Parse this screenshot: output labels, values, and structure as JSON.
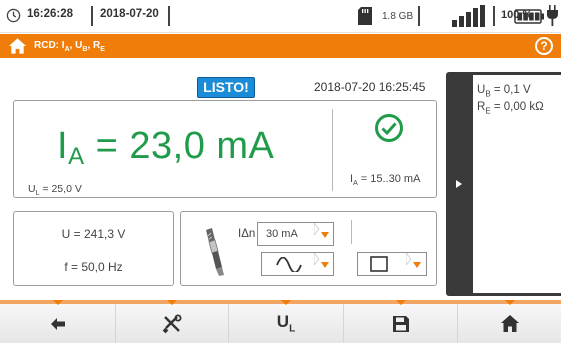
{
  "status_bar": {
    "time": "16:26:28",
    "date": "2018-07-20",
    "storage": "1.8 GB",
    "battery": "100 %",
    "icons": [
      "clock-icon",
      "sd-card-icon",
      "signal-bars-icon",
      "battery-icon",
      "plug-icon"
    ]
  },
  "header": {
    "title": "RCD: I",
    "title_sub_a": "A",
    "title_sep1": ", U",
    "title_sub_b": "B",
    "title_sep2": ", R",
    "title_sub_e": "E",
    "help": "?",
    "icons": [
      "home-icon",
      "help-icon"
    ]
  },
  "measurement": {
    "status": "LISTO!",
    "timestamp": "2018-07-20 16:25:45",
    "main_symbol": "I",
    "main_sub": "A",
    "main_value": " = 23,0 mA",
    "ul_symbol": "U",
    "ul_sub": "L",
    "ul_value": " = 25,0 V",
    "range_symbol": "I",
    "range_sub": "A",
    "range_value": " = 15..30 mA",
    "result_icon": "check-circle-icon"
  },
  "side_panel": {
    "ub_symbol": "U",
    "ub_sub": "B",
    "ub_value": " = 0,1 V",
    "re_symbol": "R",
    "re_sub": "E",
    "re_value": " = 0,00 kΩ"
  },
  "voltage": {
    "u": "U = 241,3 V",
    "f": "f = 50,0 Hz"
  },
  "settings": {
    "idn_label": "IΔn",
    "idn_value": "30 mA",
    "waveform_icon": "sine-wave-icon",
    "type_icon": "square-type-icon",
    "probe_icon": "probe-clamp-icon"
  },
  "toolbar": {
    "ul_symbol": "U",
    "ul_sub": "L",
    "icons": [
      "back-arrow-icon",
      "tools-icon",
      "save-icon",
      "home-icon"
    ]
  },
  "colors": {
    "accent_orange": "#f07d0a",
    "result_green": "#1f9b4a",
    "badge_blue": "#1b8cd8",
    "side_dark": "#3a3a3a"
  }
}
